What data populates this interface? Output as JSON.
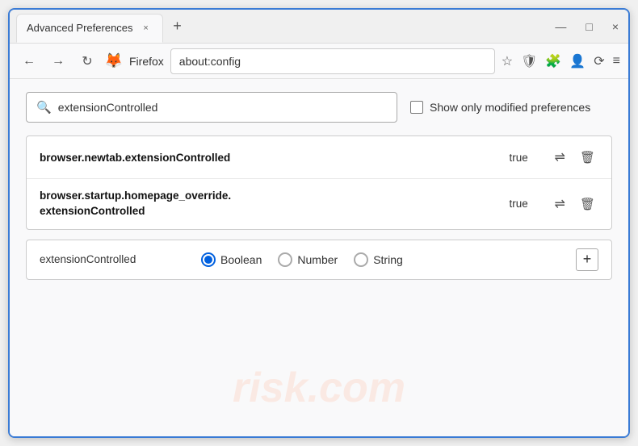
{
  "window": {
    "title": "Advanced Preferences",
    "tab_close": "×",
    "new_tab": "+",
    "minimize": "—",
    "maximize": "□",
    "close": "×"
  },
  "navbar": {
    "back": "←",
    "forward": "→",
    "reload": "↻",
    "firefox_label": "Firefox",
    "address": "about:config",
    "bookmark_icon": "☆",
    "shield_icon": "🛡",
    "extension_icon": "🧩",
    "profile_icon": "👤",
    "sync_icon": "⟳",
    "menu_icon": "≡"
  },
  "search": {
    "placeholder": "extensionControlled",
    "search_value": "extensionControlled",
    "search_icon": "🔍",
    "checkbox_label": "Show only modified preferences"
  },
  "results": [
    {
      "name": "browser.newtab.extensionControlled",
      "value": "true",
      "multiline": false
    },
    {
      "name": "browser.startup.homepage_override.\nextensionControlled",
      "name_line1": "browser.startup.homepage_override.",
      "name_line2": "extensionControlled",
      "value": "true",
      "multiline": true
    }
  ],
  "add_pref": {
    "name": "extensionControlled",
    "types": [
      "Boolean",
      "Number",
      "String"
    ],
    "selected_type": "Boolean",
    "add_btn": "+"
  },
  "watermark": "risk.com"
}
